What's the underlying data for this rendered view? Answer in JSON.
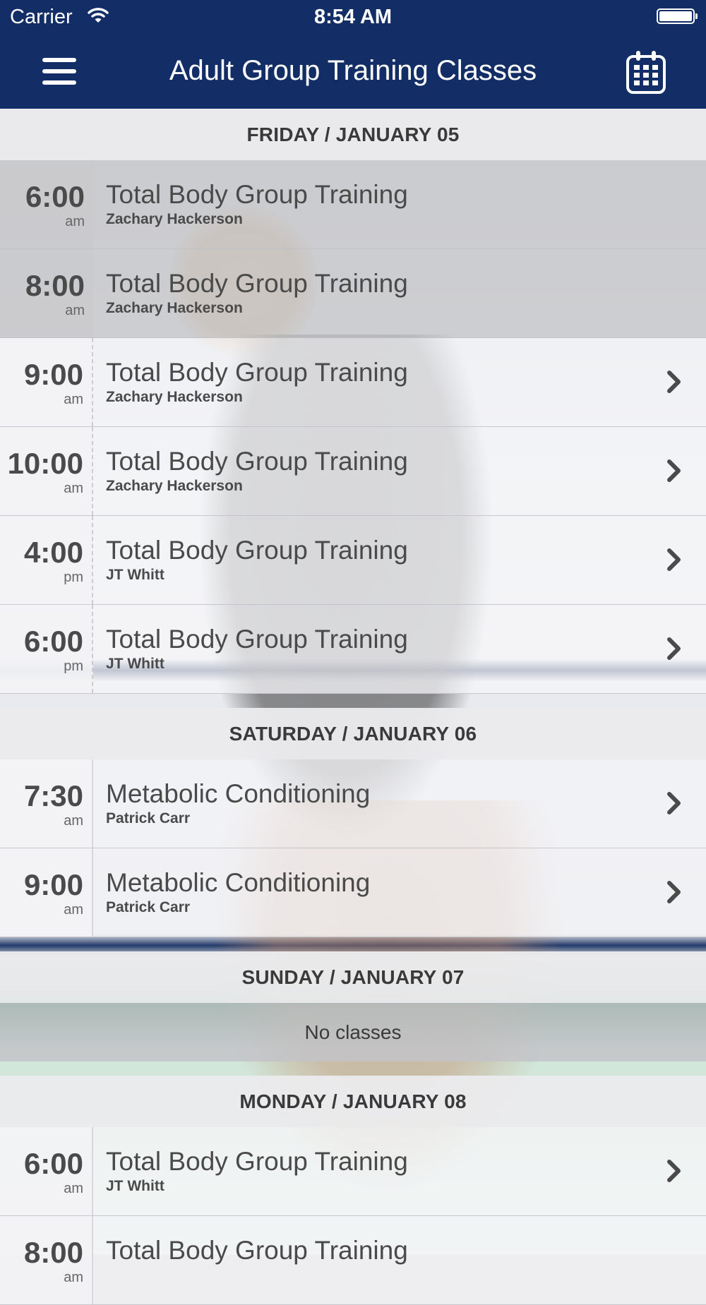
{
  "status_bar": {
    "carrier": "Carrier",
    "time": "8:54 AM"
  },
  "nav": {
    "title": "Adult Group Training Classes"
  },
  "days": [
    {
      "header": "FRIDAY / JANUARY 05",
      "classes": [
        {
          "hour": "6:00",
          "ampm": "am",
          "name": "Total Body Group Training",
          "instructor": "Zachary Hackerson",
          "past": true
        },
        {
          "hour": "8:00",
          "ampm": "am",
          "name": "Total Body Group Training",
          "instructor": "Zachary Hackerson",
          "past": true
        },
        {
          "hour": "9:00",
          "ampm": "am",
          "name": "Total Body Group Training",
          "instructor": "Zachary Hackerson",
          "past": false
        },
        {
          "hour": "10:00",
          "ampm": "am",
          "name": "Total Body Group Training",
          "instructor": "Zachary Hackerson",
          "past": false
        },
        {
          "hour": "4:00",
          "ampm": "pm",
          "name": "Total Body Group Training",
          "instructor": "JT Whitt",
          "past": false
        },
        {
          "hour": "6:00",
          "ampm": "pm",
          "name": "Total Body Group Training",
          "instructor": "JT Whitt",
          "past": false
        }
      ]
    },
    {
      "header": "SATURDAY / JANUARY 06",
      "classes": [
        {
          "hour": "7:30",
          "ampm": "am",
          "name": "Metabolic Conditioning",
          "instructor": "Patrick Carr",
          "past": false
        },
        {
          "hour": "9:00",
          "ampm": "am",
          "name": "Metabolic Conditioning",
          "instructor": "Patrick Carr",
          "past": false
        }
      ]
    },
    {
      "header": "SUNDAY / JANUARY 07",
      "no_classes": "No classes",
      "classes": []
    },
    {
      "header": "MONDAY / JANUARY 08",
      "classes": [
        {
          "hour": "6:00",
          "ampm": "am",
          "name": "Total Body Group Training",
          "instructor": "JT Whitt",
          "past": false
        },
        {
          "hour": "8:00",
          "ampm": "am",
          "name": "Total Body Group Training",
          "instructor": "",
          "past": false
        }
      ]
    }
  ]
}
